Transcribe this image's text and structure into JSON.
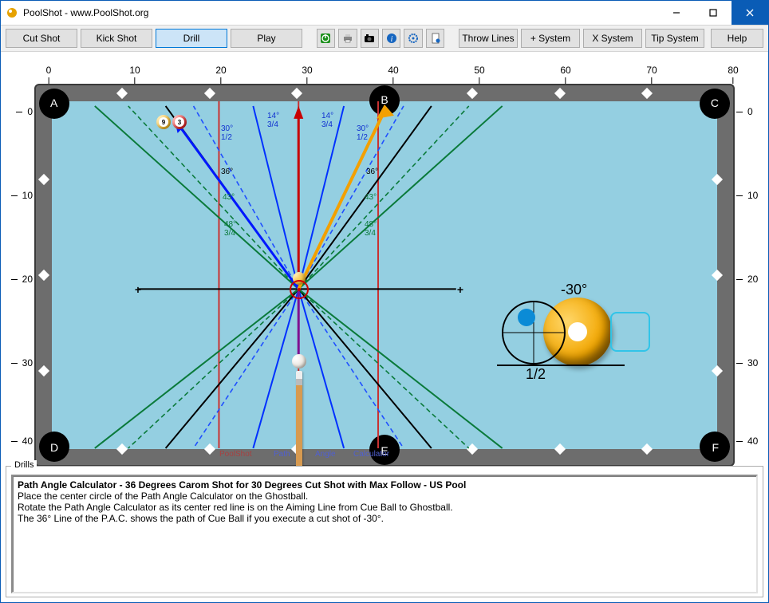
{
  "titlebar": {
    "title": "PoolShot - www.PoolShot.org"
  },
  "toolbar": {
    "cut_shot": "Cut Shot",
    "kick_shot": "Kick Shot",
    "drill": "Drill",
    "play": "Play",
    "throw_lines": "Throw Lines",
    "plus_system": "+ System",
    "x_system": "X System",
    "tip_system": "Tip System",
    "help": "Help"
  },
  "ruler": {
    "top": [
      "0",
      "10",
      "20",
      "30",
      "40",
      "50",
      "60",
      "70",
      "80"
    ],
    "side": [
      "0",
      "10",
      "20",
      "30",
      "40"
    ]
  },
  "pockets": {
    "A": "A",
    "B": "B",
    "C": "C",
    "D": "D",
    "E": "E",
    "F": "F"
  },
  "balls": {
    "nine": "9",
    "three": "3"
  },
  "angle_labels": {
    "tl30": "30°",
    "tl30f": "1/2",
    "tl14": "14°",
    "tl14f": "3/4",
    "tr14": "14°",
    "tr14f": "3/4",
    "tr30": "30°",
    "tr30f": "1/2",
    "l36": "36°",
    "l43": "43°",
    "l48": "48°",
    "l48f": "3/4",
    "r36": "36°",
    "r43": "43°",
    "r48": "48°",
    "r48f": "3/4"
  },
  "watermark": {
    "poolshot": "PoolShot",
    "path": "Path",
    "angle": "Angle",
    "calc": "Calculator"
  },
  "inset": {
    "angle": "-30°",
    "half": "1/2"
  },
  "bottom": {
    "legend": "Drills",
    "title": "Path Angle Calculator - 36 Degrees Carom Shot for 30 Degrees Cut Shot with Max Follow - US Pool",
    "l1": "Place the center circle of the Path Angle Calculator on the Ghostball.",
    "l2": "Rotate the Path Angle Calculator as its center red line is on the Aiming Line from Cue Ball to Ghostball.",
    "l3": "The 36° Line of the P.A.C. shows the path of Cue Ball if you execute a cut shot of -30°."
  }
}
